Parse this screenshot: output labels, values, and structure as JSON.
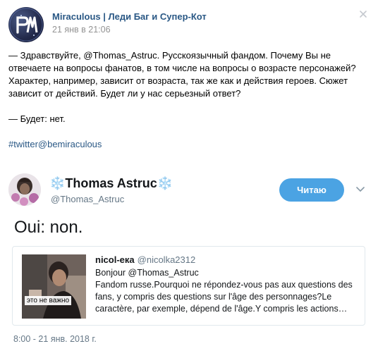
{
  "post": {
    "author": "Miraculous | Леди Баг и Супер-Кот",
    "date": "21 янв в 21:06",
    "avatar_text": "ЛМ",
    "quote": "— Здравствуйте, @Thomas_Astruc. Русскоязычный фандом. Почему Вы не отвечаете на вопросы фанатов, в том числе на вопросы о возрасте персонажей? Характер, например, зависит от возраста, так же как и действия героев. Сюжет зависит от действий. Будет ли у нас серьезный ответ?",
    "answer": "— Будет: нет.",
    "hashtag": "#twitter@bemiraculous"
  },
  "tweet": {
    "name": "Thomas Astruc",
    "flake_left": "❄️",
    "flake_right": "❄️",
    "handle": "@Thomas_Astruc",
    "follow_label": "Читаю",
    "text": "Oui: non.",
    "date": "8:00 - 21 янв. 2018 г.",
    "quoted": {
      "name": "nicol-ека",
      "handle": "@nicolka2312",
      "thumb_caption": "это не важно",
      "text": "Bonjour @Thomas_Astruc\nFandom russe.Pourquoi ne répondez-vous pas aux questions des fans, y compris des questions sur l'âge des personnages?Le caractère, par exemple, dépend de l'âge.Y compris les actions…"
    }
  },
  "colors": {
    "link": "#2a5885",
    "follow_button": "#4ba3e3",
    "muted": "#939393",
    "tweet_muted": "#657786",
    "flake": "#8dc4ec"
  },
  "icons": [
    "close-icon",
    "chevron-down-icon",
    "snowflake-icon"
  ]
}
